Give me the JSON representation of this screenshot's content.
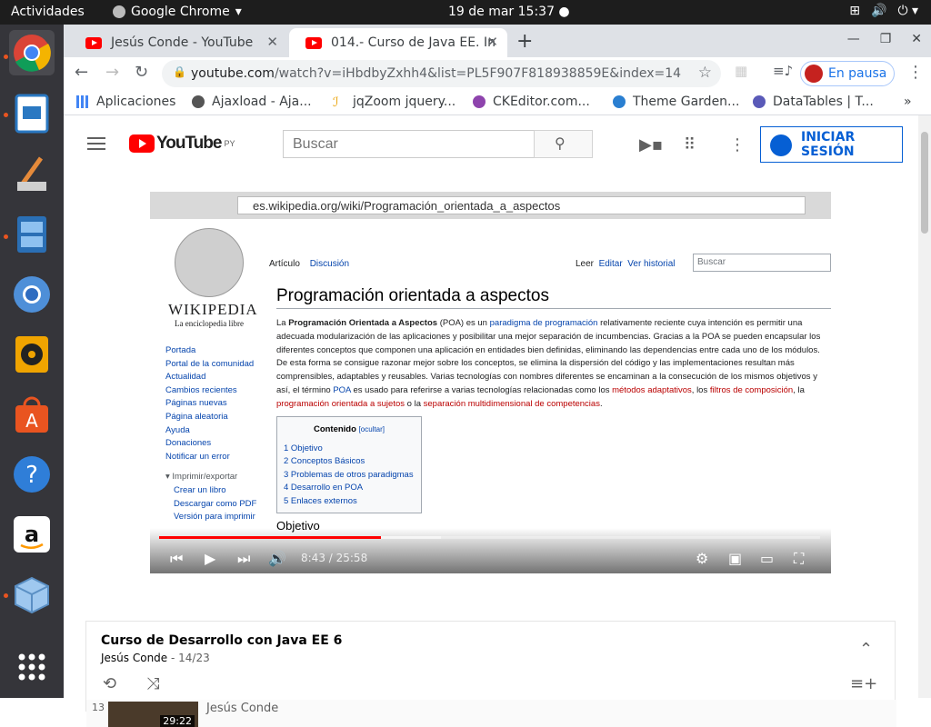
{
  "topbar": {
    "activities": "Actividades",
    "app_name": "Google Chrome",
    "clock": "19 de mar  15:37"
  },
  "dock": {
    "items": [
      "chrome-app",
      "text-editor-app",
      "paint-app",
      "files-app",
      "chromium-app",
      "rhythmbox-app",
      "software-app",
      "help-app",
      "amazon-app",
      "virtualbox-app",
      "show-apps"
    ]
  },
  "browser": {
    "tabs": [
      {
        "label": "Jesús Conde - YouTube"
      },
      {
        "label": "014.- Curso de Java EE. Int"
      }
    ],
    "url_host": "youtube.com",
    "url_path": "/watch?v=iHbdbyZxhh4&list=PL5F907F818938859E&index=14",
    "profile_label": "En pausa",
    "bookmarks": [
      "Aplicaciones",
      "Ajaxload - Aja...",
      "jqZoom jquery...",
      "CKEditor.com...",
      "Theme Garden...",
      "DataTables | T..."
    ]
  },
  "youtube": {
    "region": "PY",
    "search_placeholder": "Buscar",
    "signin_label": "INICIAR SESIÓN"
  },
  "video": {
    "time": "8:43 / 25:58",
    "progress_fraction": 0.336,
    "wiki_url": "es.wikipedia.org/wiki/Programación_orientada_a_aspectos",
    "wiki_logo_title": "WIKIPEDIA",
    "wiki_logo_sub": "La enciclopedia libre",
    "wiki_tabs": [
      "Artículo",
      "Discusión",
      "Leer",
      "Editar",
      "Ver historial"
    ],
    "wiki_search": "Buscar",
    "wiki_title": "Programación orientada a aspectos",
    "sidebar": [
      "Portada",
      "Portal de la comunidad",
      "Actualidad",
      "Cambios recientes",
      "Páginas nuevas",
      "Página aleatoria",
      "Ayuda",
      "Donaciones",
      "Notificar un error"
    ],
    "print_heading": "Imprimir/exportar",
    "print_links": [
      "Crear un libro",
      "Descargar como PDF",
      "Versión para imprimir"
    ],
    "toc_heading": "Contenido",
    "toc": [
      "1 Objetivo",
      "2 Conceptos Básicos",
      "3 Problemas de otros paradigmas",
      "4 Desarrollo en POA",
      "5 Enlaces externos"
    ],
    "section": "Objetivo"
  },
  "playlist": {
    "title": "Curso de Desarrollo con Java EE 6",
    "author": "Jesús Conde",
    "position": "14/23",
    "next_number": "13",
    "next_channel": "Jesús Conde",
    "next_duration": "29:22"
  }
}
